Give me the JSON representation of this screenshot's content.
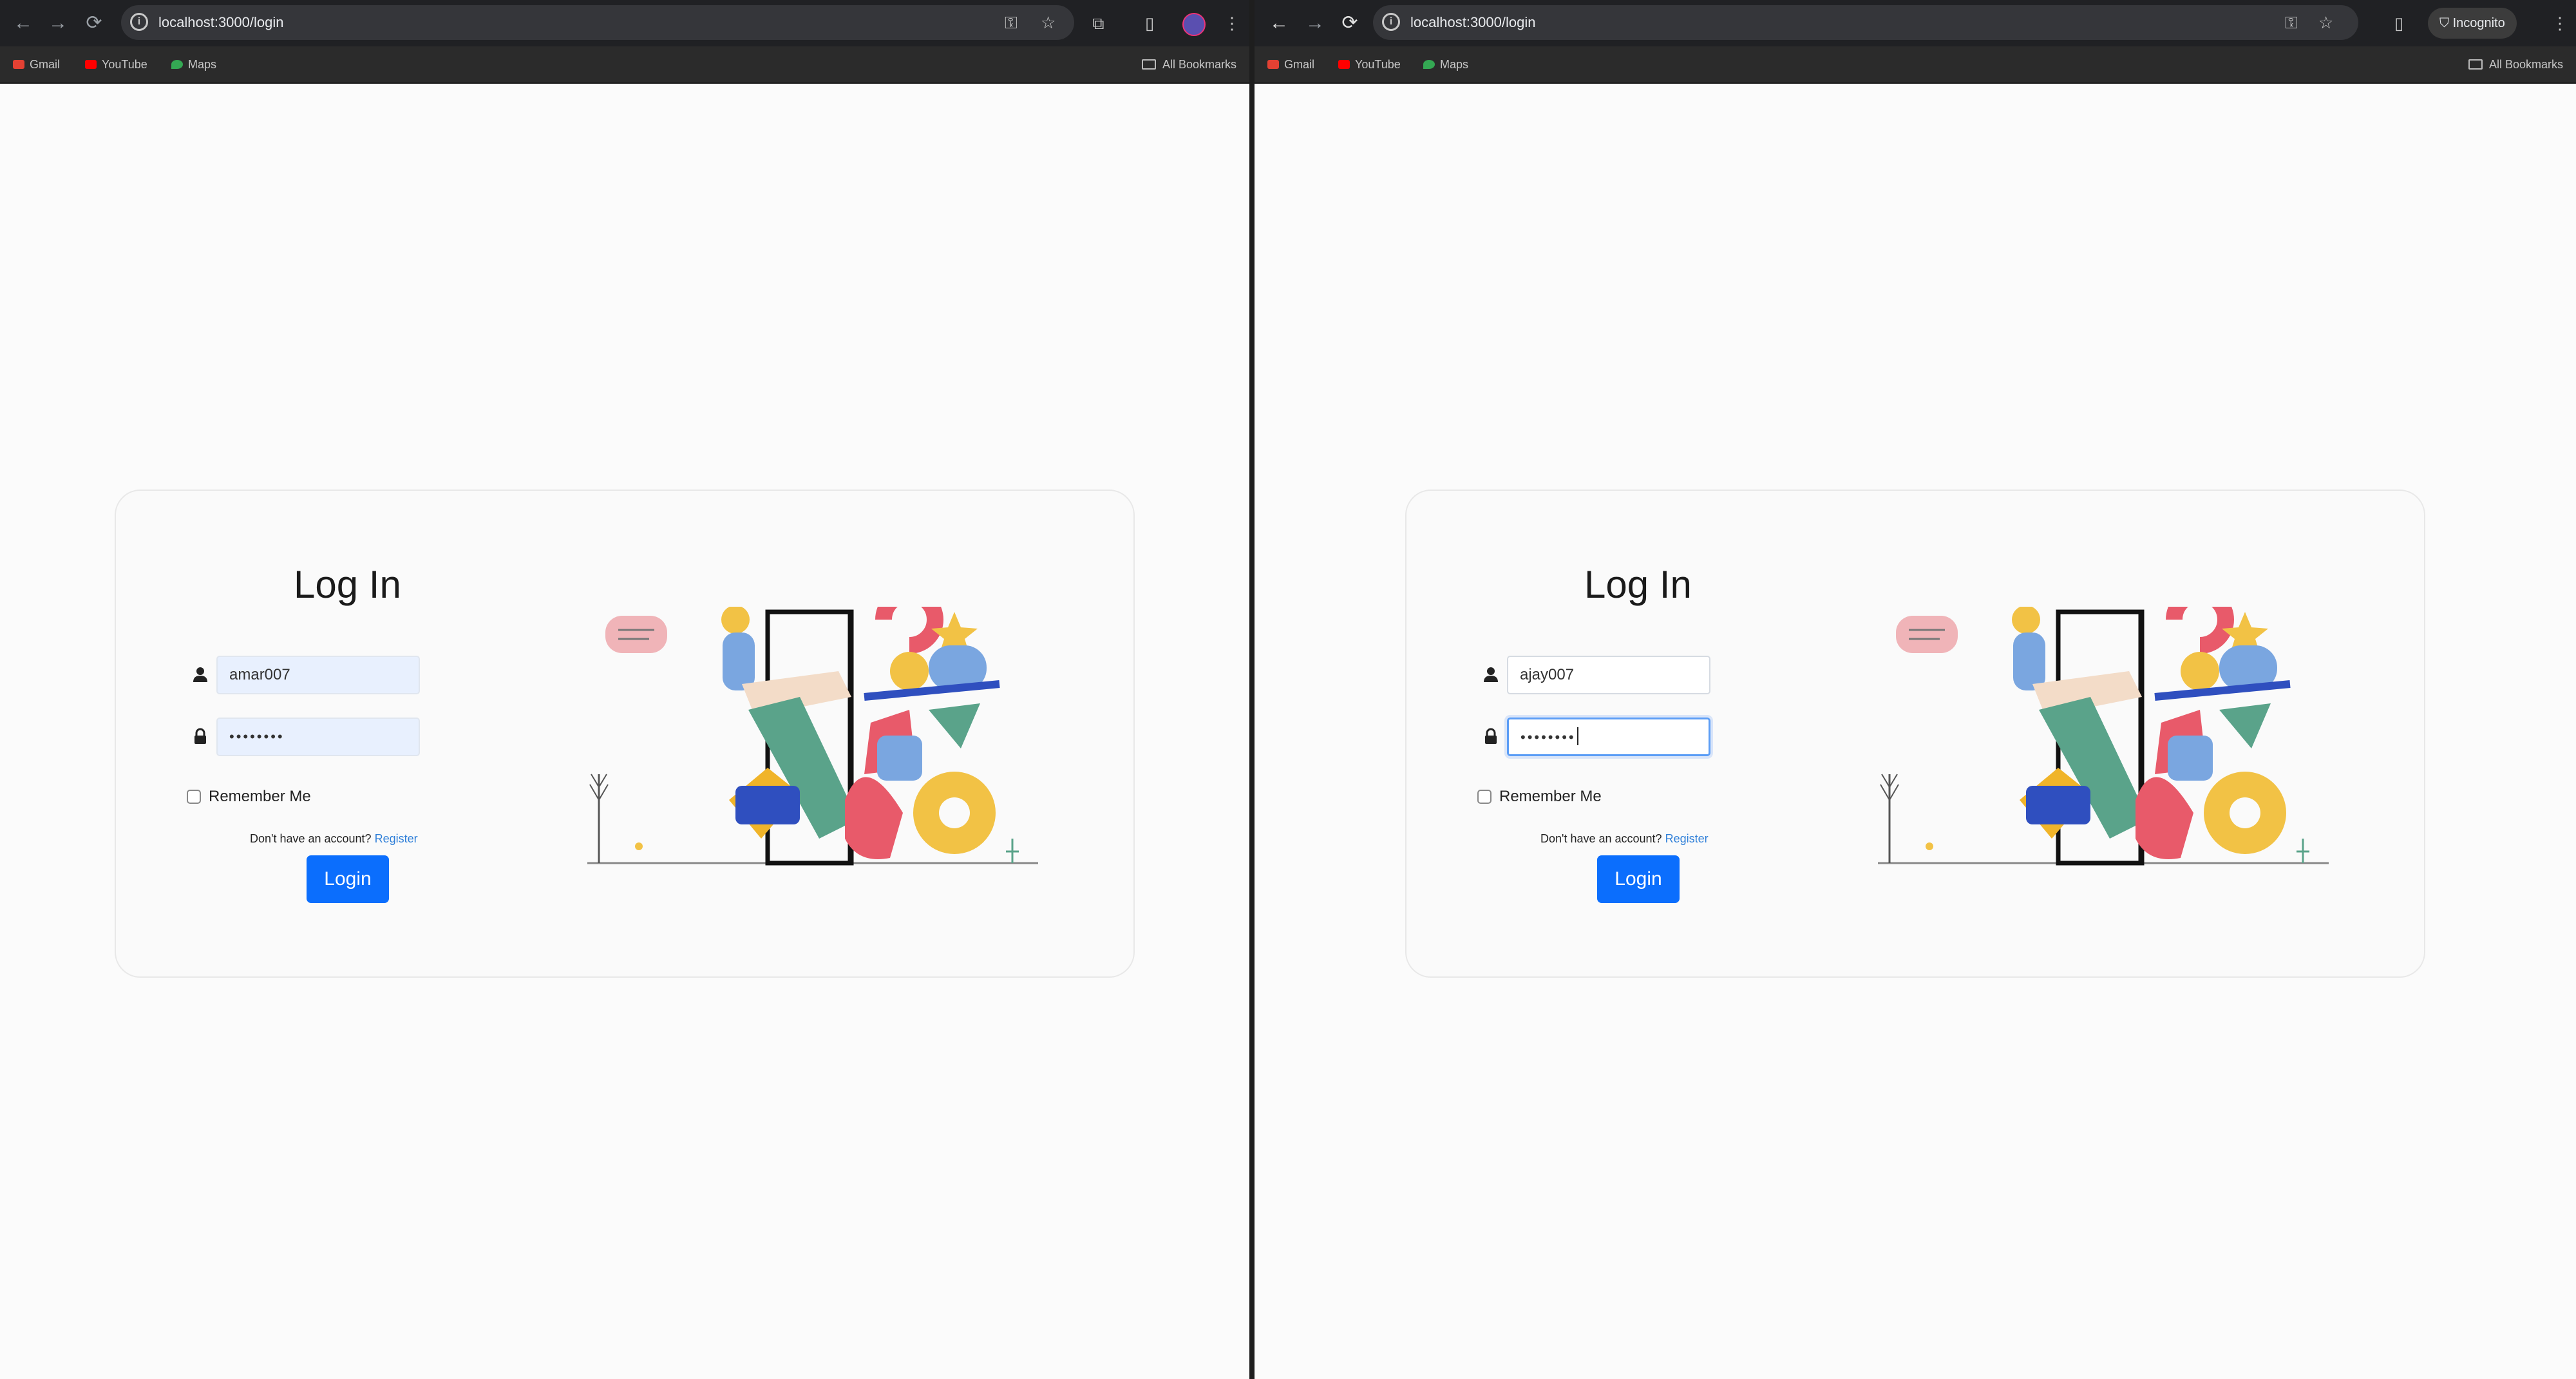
{
  "left_window": {
    "url": "localhost:3000/login",
    "bookmarks": [
      "Gmail",
      "YouTube",
      "Maps"
    ],
    "all_bookmarks": "All Bookmarks",
    "login": {
      "title": "Log In",
      "username_value": "amar007",
      "password_mask": "••••••••",
      "remember_label": "Remember Me",
      "signup_text": "Don't have an account?",
      "register_link": "Register",
      "login_button": "Login"
    }
  },
  "right_window": {
    "url": "localhost:3000/login",
    "bookmarks": [
      "Gmail",
      "YouTube",
      "Maps"
    ],
    "all_bookmarks": "All Bookmarks",
    "incognito_label": "Incognito",
    "login": {
      "title": "Log In",
      "username_value": "ajay007",
      "password_mask": "••••••••",
      "remember_label": "Remember Me",
      "signup_text": "Don't have an account?",
      "register_link": "Register",
      "login_button": "Login"
    }
  },
  "colors": {
    "primary_button": "#0b6efd",
    "link": "#2f7fd8",
    "autofill_bg": "#e8f0fe",
    "toolbar_bg": "#202124"
  },
  "icons": [
    "back-arrow-icon",
    "forward-arrow-icon",
    "reload-icon",
    "site-info-icon",
    "password-key-icon",
    "star-bookmark-icon",
    "side-panel-icon",
    "more-menu-icon",
    "user-icon",
    "lock-icon",
    "folder-icon",
    "incognito-icon"
  ]
}
